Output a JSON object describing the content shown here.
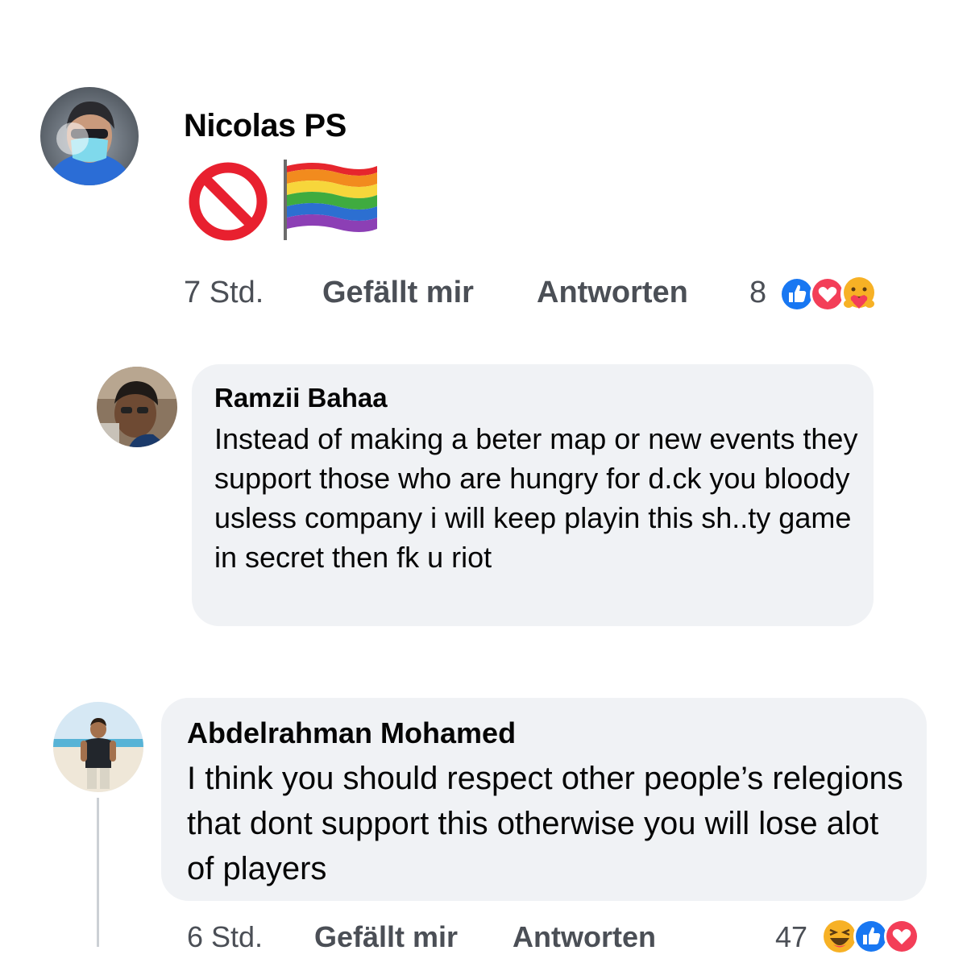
{
  "comments": [
    {
      "author": "Nicolas PS",
      "content_emojis": [
        "prohibited-icon",
        "rainbow-flag-icon"
      ],
      "time": "7 Std.",
      "like_label": "Gefällt mir",
      "reply_label": "Antworten",
      "reaction_count": "8",
      "reactions": [
        "like-reaction-icon",
        "love-reaction-icon",
        "care-reaction-icon"
      ]
    },
    {
      "author": "Ramzii Bahaa",
      "text": "Instead of making a beter map or new events they support those who are hungry for d.ck you bloody usless company i will keep playin this sh..ty game in secret then fk u riot"
    },
    {
      "author": "Abdelrahman Mohamed",
      "text": "I think you should respect other people’s relegions that dont support this otherwise you will lose alot of players",
      "time": "6 Std.",
      "like_label": "Gefällt mir",
      "reply_label": "Antworten",
      "reaction_count": "47",
      "reactions": [
        "haha-reaction-icon",
        "like-reaction-icon",
        "love-reaction-icon"
      ]
    }
  ],
  "colors": {
    "bubble_bg": "#f0f2f5",
    "meta_text": "#4b4f56",
    "like_blue": "#1877f2",
    "love_red": "#f33e58",
    "reaction_yellow": "#f7b125"
  }
}
